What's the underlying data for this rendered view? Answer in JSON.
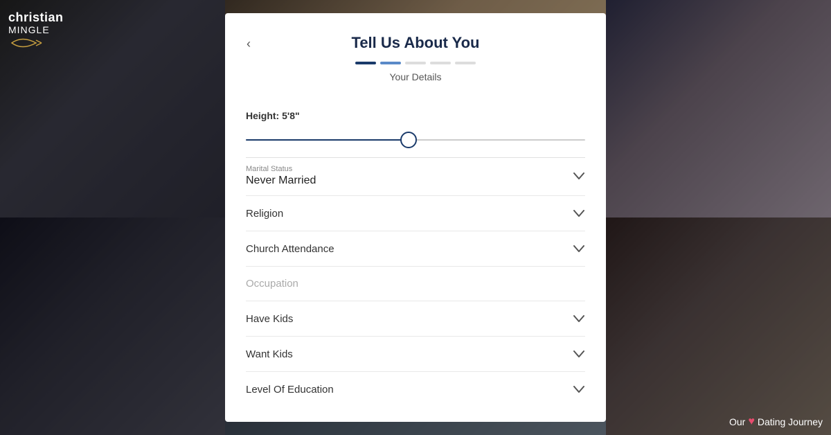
{
  "app": {
    "name_christian": "christian",
    "name_mingle": "MINGLE"
  },
  "bottom_right": {
    "prefix": "Our",
    "suffix": "Dating Journey"
  },
  "modal": {
    "title": "Tell Us About You",
    "subtitle": "Your Details",
    "back_label": "‹",
    "progress": {
      "dots": [
        "active",
        "semi-active",
        "inactive",
        "inactive",
        "inactive"
      ]
    },
    "height": {
      "label": "Height:",
      "value": "5'8\""
    },
    "marital_status": {
      "label": "Marital Status",
      "value": "Never Married"
    },
    "religion": {
      "label": "Religion"
    },
    "church_attendance": {
      "label": "Church Attendance"
    },
    "occupation": {
      "label": "Occupation",
      "placeholder": "Occupation"
    },
    "have_kids": {
      "label": "Have Kids"
    },
    "want_kids": {
      "label": "Want Kids"
    },
    "level_of_education": {
      "label": "Level Of Education"
    }
  }
}
